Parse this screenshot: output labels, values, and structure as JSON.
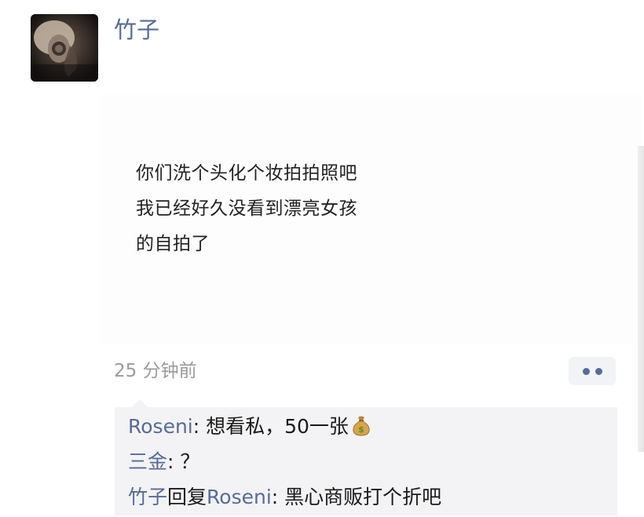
{
  "post": {
    "author": "竹子",
    "lines": [
      "你们洗个头化个妆拍拍照吧",
      "我已经好久没看到漂亮女孩",
      "的自拍了"
    ],
    "timestamp": "25 分钟前",
    "more_icon": "more-dots-icon"
  },
  "comments": [
    {
      "name": "Roseni",
      "separator": ": ",
      "text": "想看私，50一张",
      "emoji": "money-bag-icon"
    },
    {
      "name": "三金",
      "separator": ": ",
      "text": "？"
    },
    {
      "name": "竹子",
      "reply_word": "回复",
      "reply_to": "Roseni",
      "separator": ": ",
      "text": "黑心商贩打个折吧"
    }
  ],
  "colors": {
    "name": "#576b95",
    "text": "#222222",
    "timestamp": "#9b9b9b",
    "comment_bg": "#f3f3f5"
  }
}
